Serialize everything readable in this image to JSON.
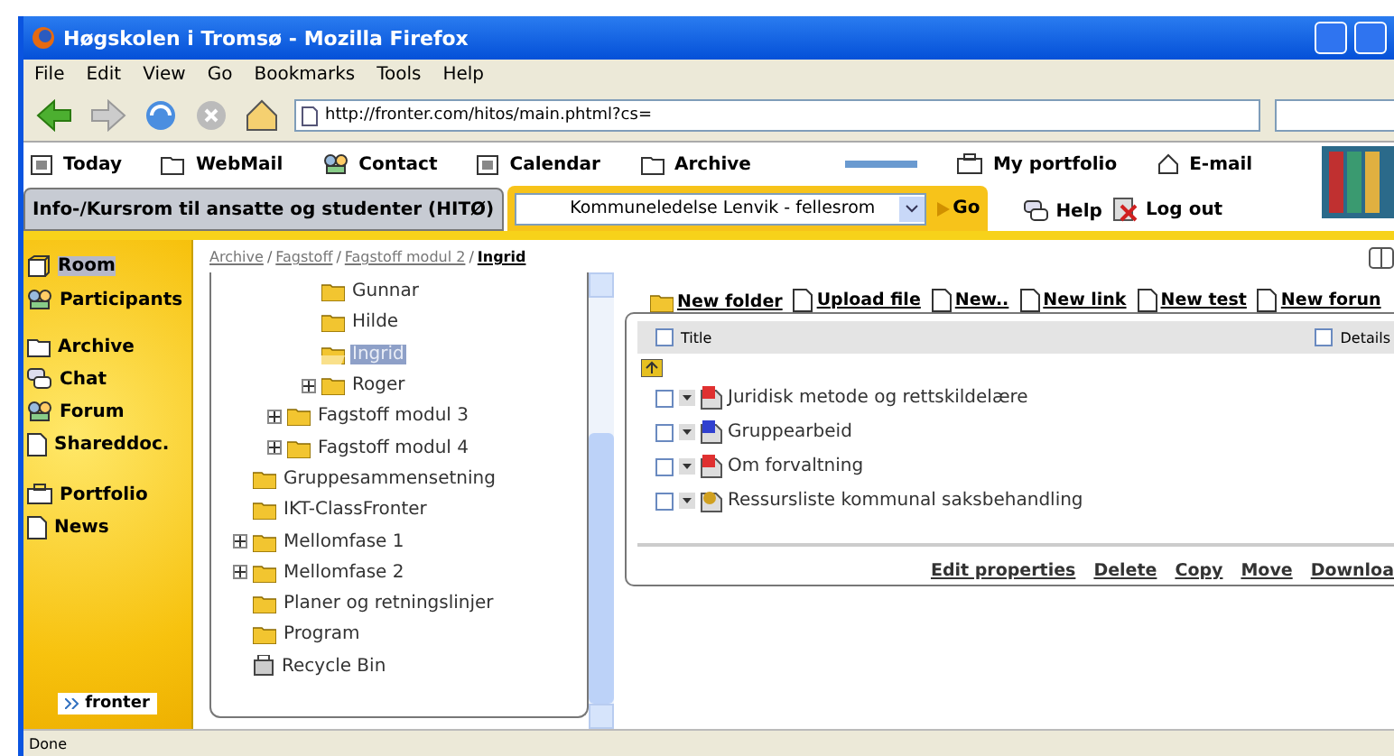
{
  "window": {
    "title": "Høgskolen i Tromsø - Mozilla Firefox"
  },
  "menu": [
    "File",
    "Edit",
    "View",
    "Go",
    "Bookmarks",
    "Tools",
    "Help"
  ],
  "address": {
    "value": "http://fronter.com/hitos/main.phtml?cs="
  },
  "top_nav": [
    {
      "label": "Today",
      "kind": "calendar"
    },
    {
      "label": "WebMail",
      "kind": "folder"
    },
    {
      "label": "Contact",
      "kind": "people"
    },
    {
      "label": "Calendar",
      "kind": "calendar"
    },
    {
      "label": "Archive",
      "kind": "folder"
    },
    {
      "label": "My portfolio",
      "kind": "portfolio"
    },
    {
      "label": "E-mail",
      "kind": "mail"
    }
  ],
  "room_tab": {
    "label": "Info-/Kursrom til ansatte og studenter (HITØ)"
  },
  "room_select": {
    "value": "Kommuneledelse Lenvik - fellesrom"
  },
  "go_button": "Go",
  "help": "Help",
  "logout": "Log out",
  "sidebar": [
    [
      {
        "label": "Room",
        "kind": "room",
        "selected": true
      },
      {
        "label": "Participants",
        "kind": "people",
        "selected": false
      }
    ],
    [
      {
        "label": "Archive",
        "kind": "folder",
        "selected": false
      },
      {
        "label": "Chat",
        "kind": "chat",
        "selected": false
      },
      {
        "label": "Forum",
        "kind": "people",
        "selected": false
      },
      {
        "label": "Shareddoc.",
        "kind": "doc",
        "selected": false
      }
    ],
    [
      {
        "label": "Portfolio",
        "kind": "portfolio",
        "selected": false
      },
      {
        "label": "News",
        "kind": "doc",
        "selected": false
      }
    ]
  ],
  "brand": "fronter",
  "breadcrumb": {
    "separator": "/",
    "items": [
      "Archive",
      "Fagstoff",
      "Fagstoff modul 2",
      "Ingrid"
    ]
  },
  "tree": [
    {
      "children": [
        {
          "children": [
            {
              "label": "Gunnar",
              "kind": "folder",
              "expander": false,
              "selected": false
            },
            {
              "label": "Hilde",
              "kind": "folder",
              "expander": false,
              "selected": false
            },
            {
              "label": "Ingrid",
              "kind": "folder",
              "expander": false,
              "selected": true
            },
            {
              "label": "Roger",
              "kind": "folder",
              "expander": true,
              "selected": false
            }
          ]
        },
        {
          "label": "Fagstoff modul 3",
          "kind": "folder",
          "expander": true,
          "selected": false
        },
        {
          "label": "Fagstoff modul 4",
          "kind": "folder",
          "expander": true,
          "selected": false
        }
      ]
    },
    {
      "label": "Gruppesammensetning",
      "kind": "folder",
      "expander": false,
      "selected": false
    },
    {
      "label": "IKT-ClassFronter",
      "kind": "folder",
      "expander": false,
      "selected": false
    },
    {
      "label": "Mellomfase 1",
      "kind": "folder",
      "expander": true,
      "selected": false
    },
    {
      "label": "Mellomfase 2",
      "kind": "folder",
      "expander": true,
      "selected": false
    },
    {
      "label": "Planer og retningslinjer",
      "kind": "folder",
      "expander": false,
      "selected": false
    },
    {
      "label": "Program",
      "kind": "folder",
      "expander": false,
      "selected": false
    },
    {
      "label": "Recycle Bin",
      "kind": "bin",
      "expander": false,
      "selected": false
    }
  ],
  "toolbar": [
    "New folder",
    "Upload file",
    "New..",
    "New link",
    "New test",
    "New forun"
  ],
  "table": {
    "columns": [
      {
        "label": "Title",
        "checked": false
      },
      {
        "label": "Details",
        "checked": false
      }
    ],
    "rows": [
      {
        "title": "Juridisk metode og rettskildelære",
        "kind": "document",
        "color": "#e03030",
        "checked": false
      },
      {
        "title": "Gruppearbeid",
        "kind": "document",
        "color": "#3040d0",
        "checked": false
      },
      {
        "title": "Om forvaltning",
        "kind": "document",
        "color": "#e03030",
        "checked": false
      },
      {
        "title": "Ressursliste kommunal saksbehandling",
        "kind": "link",
        "color": "#d0a020",
        "checked": false
      }
    ]
  },
  "actions": [
    "Edit properties",
    "Delete",
    "Copy",
    "Move",
    "Downloa"
  ],
  "status_bar": "Done"
}
